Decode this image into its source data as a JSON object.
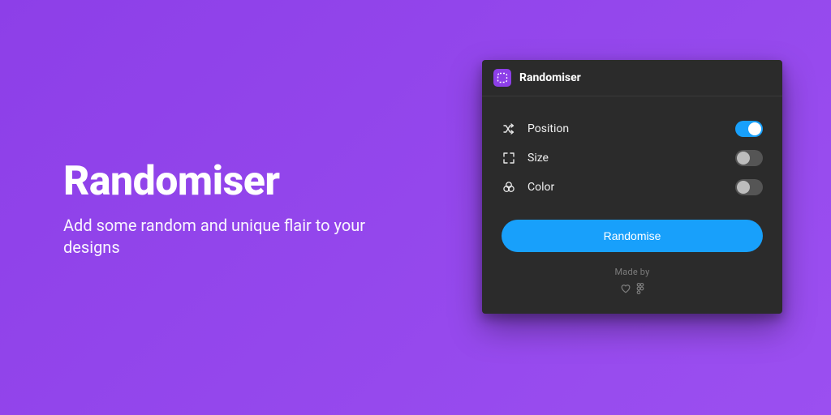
{
  "colors": {
    "background": "#8d3fe8",
    "panel_bg": "#2b2b2b",
    "accent": "#18a0fb"
  },
  "promo": {
    "title": "Randomiser",
    "subtitle": "Add some random and unique flair to your designs"
  },
  "panel": {
    "title": "Randomiser",
    "options": [
      {
        "icon": "shuffle-icon",
        "label": "Position",
        "on": true
      },
      {
        "icon": "expand-icon",
        "label": "Size",
        "on": false
      },
      {
        "icon": "color-icon",
        "label": "Color",
        "on": false
      }
    ],
    "button_label": "Randomise",
    "madeby_label": "Made by"
  }
}
